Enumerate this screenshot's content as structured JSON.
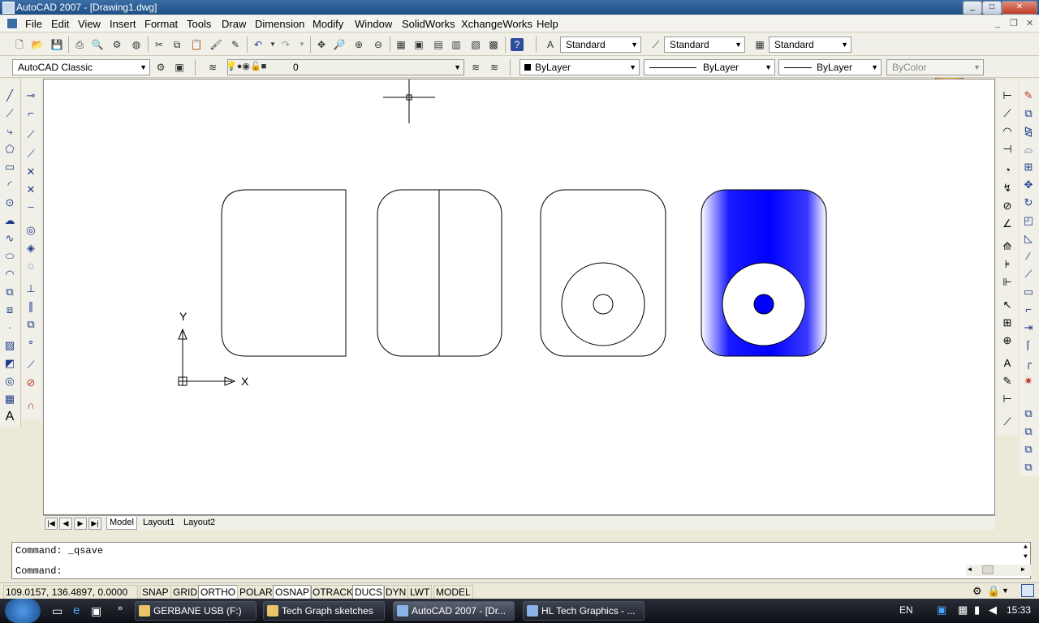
{
  "window": {
    "title": "AutoCAD 2007 - [Drawing1.dwg]",
    "controls": [
      "_",
      "□",
      "✕"
    ]
  },
  "menu": [
    "File",
    "Edit",
    "View",
    "Insert",
    "Format",
    "Tools",
    "Draw",
    "Dimension",
    "Modify",
    "Window",
    "SolidWorks",
    "XchangeWorks",
    "Help"
  ],
  "toolbar": {
    "text_style": "Standard",
    "dim_style": "Standard",
    "table_style": "Standard",
    "workspace": "AutoCAD Classic",
    "layer": "0",
    "color": "ByLayer",
    "linetype": "ByLayer",
    "lineweight": "ByLayer",
    "plotstyle": "ByColor"
  },
  "drawing": {
    "ucs_x_label": "X",
    "ucs_y_label": "Y",
    "hatch_color": "#0000ff",
    "line_color": "#000000"
  },
  "tabs": [
    "Model",
    "Layout1",
    "Layout2"
  ],
  "command": {
    "history": "Command: _qsave",
    "prompt": "Command:"
  },
  "status": {
    "coords": "109.0157, 136.4897, 0.0000",
    "toggles": [
      "SNAP",
      "GRID",
      "ORTHO",
      "POLAR",
      "OSNAP",
      "OTRACK",
      "DUCS",
      "DYN",
      "LWT",
      "MODEL"
    ]
  },
  "taskbar": {
    "items": [
      "GERBANE USB (F:)",
      "Tech Graph sketches",
      "AutoCAD 2007 - [Dr...",
      "HL Tech Graphics - ..."
    ],
    "language": "EN",
    "clock": "15:33"
  }
}
